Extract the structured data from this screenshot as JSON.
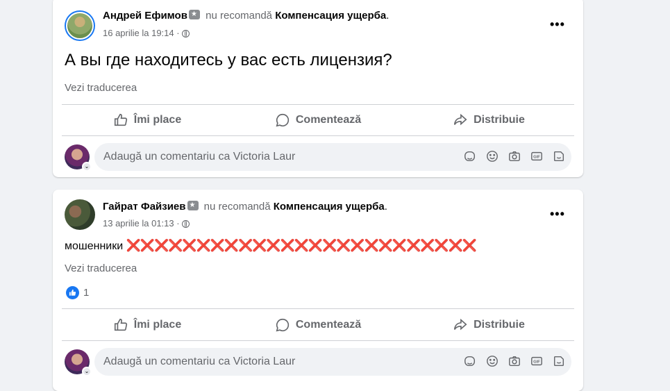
{
  "posts": [
    {
      "author": "Андрей Ефимов",
      "action_text": "nu recomandă",
      "page_name": "Компенсация ущерба",
      "period": ".",
      "timestamp": "16 aprilie la 19:14",
      "separator": "·",
      "body": "А вы где находитесь у вас есть лицензия?",
      "see_translation": "Vezi traducerea",
      "more_label": "•••"
    },
    {
      "author": "Гайрат Файзиев",
      "action_text": "nu recomandă",
      "page_name": "Компенсация ущерба",
      "period": ".",
      "timestamp": "13 aprilie la 01:13",
      "separator": "·",
      "body": "мошенники",
      "body_marks": "❌❌❌❌❌❌❌❌❌❌❌❌❌❌❌❌❌❌❌❌❌❌❌❌❌",
      "see_translation": "Vezi traducerea",
      "reaction_count": "1",
      "more_label": "•••"
    }
  ],
  "actions": {
    "like": "Îmi place",
    "comment": "Comentează",
    "share": "Distribuie"
  },
  "comment_box": {
    "placeholder": "Adaugă un comentariu ca Victoria Laur"
  },
  "colors": {
    "accent": "#1877f2",
    "muted_text": "#65676b",
    "x_mark": "#e0203a"
  }
}
